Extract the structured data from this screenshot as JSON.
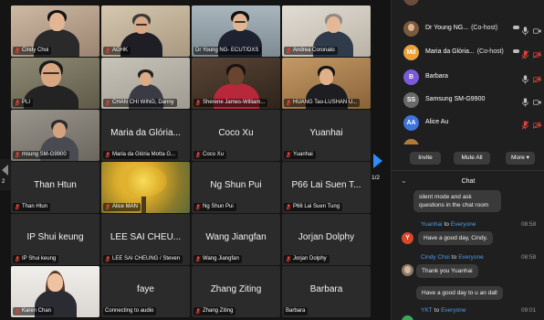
{
  "gallery": {
    "tiles": [
      {
        "label": "Cindy Choi",
        "muted": true
      },
      {
        "label": "AGHK",
        "muted": true
      },
      {
        "label": "Dr Young NG- ECUT/DXS",
        "muted": false
      },
      {
        "label": "Andrea Coronato",
        "muted": true
      },
      {
        "label": "PLI",
        "muted": true
      },
      {
        "label": "CHAN CHI WING, Danny",
        "muted": true
      },
      {
        "label": "Sherene James-William...",
        "muted": true
      },
      {
        "label": "HUANG Tao-LUSHAN U...",
        "muted": true
      },
      {
        "label": "msung SM-G9900",
        "muted": true
      },
      {
        "label": "Maria da Glória Motta G...",
        "big_name": "Maria da Glória...",
        "muted": true
      },
      {
        "label": "Coco Xu",
        "big_name": "Coco Xu",
        "muted": true
      },
      {
        "label": "Yuanhai",
        "big_name": "Yuanhai",
        "muted": true
      },
      {
        "label": "Than Htun",
        "big_name": "Than Htun",
        "muted": true
      },
      {
        "label": "Alice MAN",
        "muted": true
      },
      {
        "label": "Ng Shun Pui",
        "big_name": "Ng Shun Pui",
        "muted": true
      },
      {
        "label": "P66 Lai Suen Tung",
        "big_name": "P66 Lai Suen T...",
        "muted": true
      },
      {
        "label": "IP Shui keung",
        "big_name": "IP Shui keung",
        "muted": true
      },
      {
        "label": "LEE SAI CHEUNG / Steven",
        "big_name": "LEE SAI CHEU...",
        "muted": true
      },
      {
        "label": "Wang Jiangfan",
        "big_name": "Wang Jiangfan",
        "muted": true
      },
      {
        "label": "Jorjan Dolphy",
        "big_name": "Jorjan Dolphy",
        "muted": true
      },
      {
        "label": "Karen Chan",
        "muted": true
      },
      {
        "label": "Connecting to audio",
        "big_name": "faye",
        "muted": false
      },
      {
        "label": "Zhang Ziting",
        "big_name": "Zhang Ziting",
        "muted": true
      },
      {
        "label": "Barbara",
        "big_name": "Barbara",
        "muted": false
      }
    ],
    "page_indicator_left": "2",
    "page_indicator_right": "1/2"
  },
  "participants": {
    "items": [
      {
        "initials": "",
        "name": "Dr Young NG...",
        "role": "(Co-host)",
        "avatar_color": "#7a5a3e",
        "mic_muted": false,
        "video_off": false
      },
      {
        "initials": "Md",
        "name": "Maria da Glória...",
        "role": "(Co-host)",
        "avatar_color": "#e9a23b",
        "mic_muted": true,
        "video_off": true
      },
      {
        "initials": "B",
        "name": "Barbara",
        "role": "",
        "avatar_color": "#7b5bd6",
        "mic_muted": false,
        "video_off": true
      },
      {
        "initials": "SS",
        "name": "Samsung SM-G9900",
        "role": "",
        "avatar_color": "#6a6a6a",
        "mic_muted": false,
        "video_off": false
      },
      {
        "initials": "AA",
        "name": "Alice Au",
        "role": "",
        "avatar_color": "#3c74da",
        "mic_muted": true,
        "video_off": true
      }
    ],
    "invite_label": "Invite",
    "mute_all_label": "Mute All",
    "more_label": "More ▾"
  },
  "chat": {
    "title": "Chat",
    "continued_text": "silent mode and ask questions in the chat room",
    "messages": [
      {
        "sender": "Yuanhai",
        "to": "to",
        "recipient": "Everyone",
        "time": "08:58",
        "initial": "Y",
        "avatar_color": "#d9472b",
        "texts": [
          "Have a good day, Cindy."
        ]
      },
      {
        "sender": "Cindy Choi",
        "to": "to",
        "recipient": "Everyone",
        "time": "08:58",
        "initial": "",
        "avatar_color": "#8a7a6a",
        "texts": [
          "Thank you Yuanhai",
          "Have a good day to u an dall"
        ]
      },
      {
        "sender": "YKT",
        "to": "to",
        "recipient": "Everyone",
        "time": "09:01",
        "initial": "",
        "avatar_color": "#3aa85a",
        "texts": []
      }
    ]
  },
  "colors": {
    "accent_blue": "#2d8cff",
    "active_speaker": "#36c24c",
    "muted_red": "#e0433a",
    "link_blue": "#4d9be8"
  }
}
